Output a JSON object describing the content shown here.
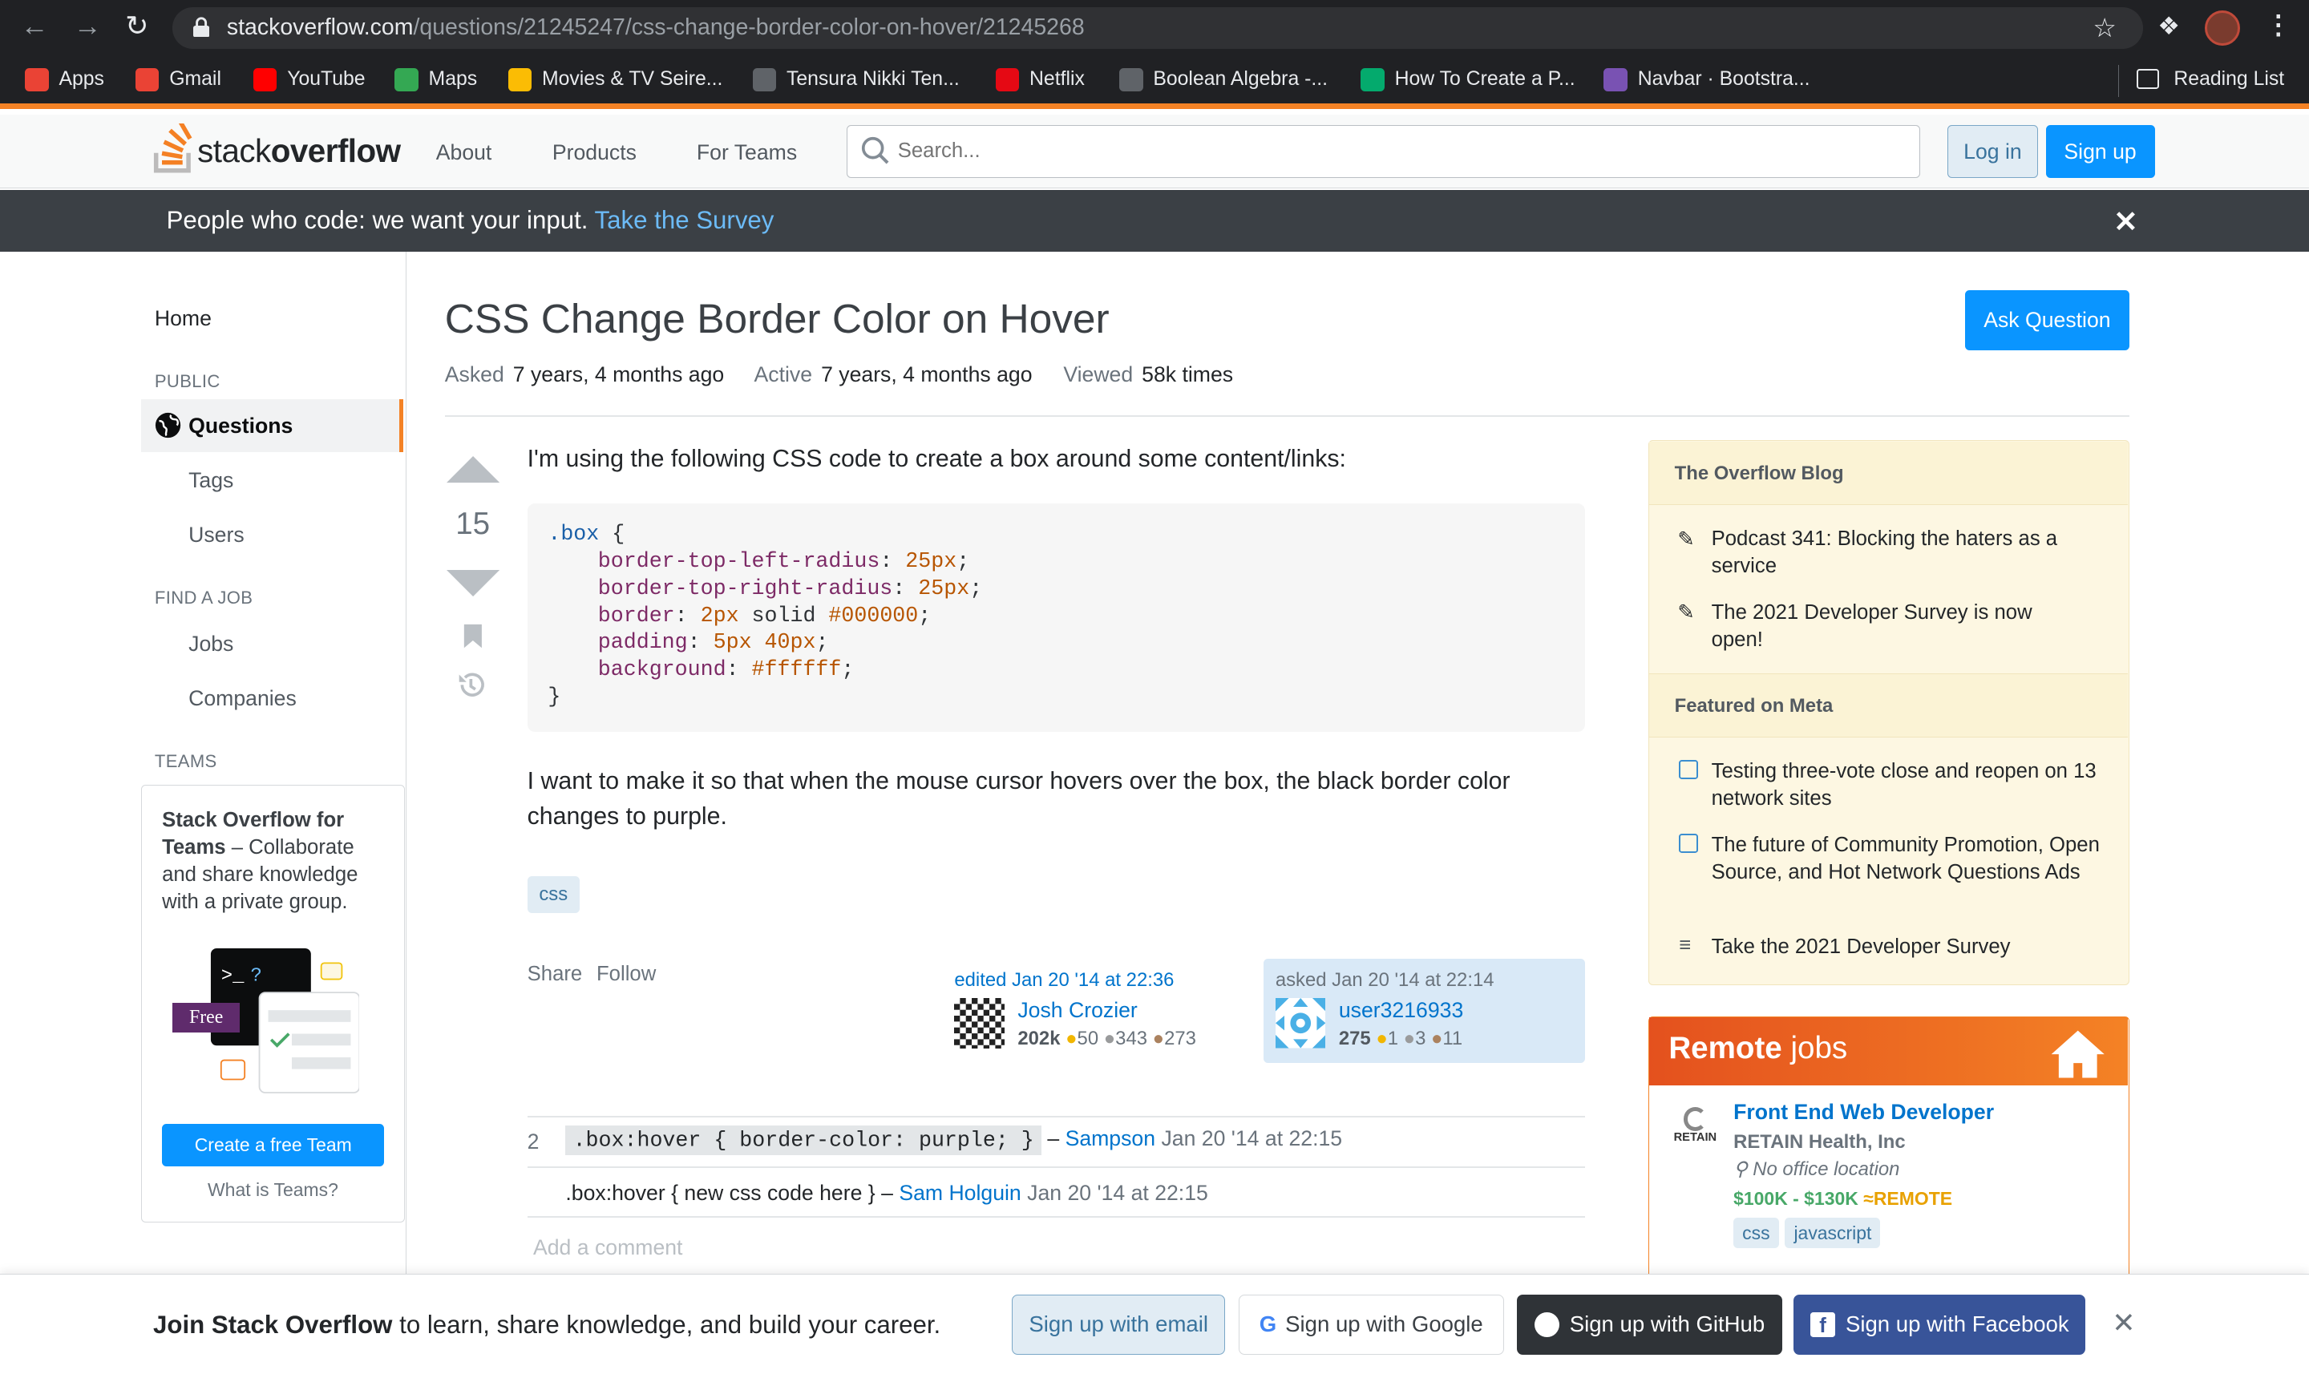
{
  "browser": {
    "url_host": "stackoverflow.com",
    "url_path": "/questions/21245247/css-change-border-color-on-hover/21245268",
    "bookmarks": [
      {
        "label": "Apps",
        "color": "#ea4335"
      },
      {
        "label": "Gmail",
        "color": "#ea4335"
      },
      {
        "label": "YouTube",
        "color": "#ff0000"
      },
      {
        "label": "Maps",
        "color": "#34a853"
      },
      {
        "label": "Movies & TV Seire...",
        "color": "#fbbc04"
      },
      {
        "label": "Tensura Nikki Ten...",
        "color": "#5f6368"
      },
      {
        "label": "Netflix",
        "color": "#e50914"
      },
      {
        "label": "Boolean Algebra -...",
        "color": "#5f6368"
      },
      {
        "label": "How To Create a P...",
        "color": "#04aa6d"
      },
      {
        "label": "Navbar · Bootstra...",
        "color": "#7952b3"
      }
    ],
    "reading_list": "Reading List"
  },
  "header": {
    "logo_a": "stack",
    "logo_b": "overflow",
    "about": "About",
    "products": "Products",
    "teams": "For Teams",
    "search_placeholder": "Search...",
    "login": "Log in",
    "signup": "Sign up"
  },
  "banner": {
    "text": "People who code: we want your input.",
    "link": "Take the Survey"
  },
  "nav": {
    "home": "Home",
    "public": "PUBLIC",
    "questions": "Questions",
    "tags": "Tags",
    "users": "Users",
    "findjob": "FIND A JOB",
    "jobs": "Jobs",
    "companies": "Companies",
    "teams": "TEAMS",
    "teams_title": "Stack Overflow for Teams",
    "teams_dash": " – ",
    "teams_desc": "Collaborate and share knowledge with a private group.",
    "free": "Free",
    "create": "Create a free Team",
    "what": "What is Teams?"
  },
  "question": {
    "title": "CSS Change Border Color on Hover",
    "ask": "Ask Question",
    "asked_label": "Asked",
    "asked": "7 years, 4 months ago",
    "active_label": "Active",
    "active": "7 years, 4 months ago",
    "viewed_label": "Viewed",
    "viewed": "58k times",
    "votes": "15",
    "intro": "I'm using the following CSS code to create a box around some content/links:",
    "outro": "I want to make it so that when the mouse cursor hovers over the box, the black border color changes to purple.",
    "tag": "css",
    "share": "Share",
    "follow": "Follow",
    "edited": "edited Jan 20 '14 at 22:36",
    "editor": "Josh Crozier",
    "editor_rep": "202k",
    "editor_gold": "50",
    "editor_silver": "343",
    "editor_bronze": "273",
    "asked_by": "asked Jan 20 '14 at 22:14",
    "asker": "user3216933",
    "asker_rep": "275",
    "asker_gold": "1",
    "asker_silver": "3",
    "asker_bronze": "11"
  },
  "code": {
    "selector": ".box",
    "open": " {",
    "close": "}",
    "lines": [
      {
        "prop": "border-top-left-radius",
        "val": "25px",
        "rest": ""
      },
      {
        "prop": "border-top-right-radius",
        "val": "25px",
        "rest": ""
      },
      {
        "prop": "border",
        "val": "2px",
        "rest": " solid "
      },
      {
        "prop": "padding",
        "val": "5px 40px",
        "rest": ""
      },
      {
        "prop": "background",
        "val": "#ffffff",
        "rest": ""
      }
    ],
    "border_hex": "#000000"
  },
  "comments": [
    {
      "score": "2",
      "code": ".box:hover { border-color: purple; }",
      "dash": " – ",
      "user": "Sampson",
      "date": "Jan 20 '14 at 22:15"
    },
    {
      "score": "",
      "text": ".box:hover { new css code here }",
      "dash": " – ",
      "user": "Sam Holguin",
      "date": "Jan 20 '14 at 22:15"
    }
  ],
  "add_comment": "Add a comment",
  "sidebar": {
    "blog": "The Overflow Blog",
    "blog_items": [
      "Podcast 341: Blocking the haters as a service",
      "The 2021 Developer Survey is now open!"
    ],
    "meta": "Featured on Meta",
    "meta_items": [
      "Testing three-vote close and reopen on 13 network sites",
      "The future of Community Promotion, Open Source, and Hot Network Questions Ads",
      "Take the 2021 Developer Survey"
    ],
    "remote_a": "Remote",
    "remote_b": " jobs",
    "job_title": "Front End Web Developer",
    "job_company": "RETAIN Health, Inc",
    "job_logo": "RETAIN",
    "job_loc": "No office location",
    "job_salary": "$100K - $130K",
    "job_remote": "REMOTE",
    "job_tags": [
      "css",
      "javascript"
    ]
  },
  "bottom": {
    "join_b": "Join Stack Overflow",
    "join": " to learn, share knowledge, and build your career.",
    "email": "Sign up with email",
    "google": "Sign up with Google",
    "github": "Sign up with GitHub",
    "facebook": "Sign up with Facebook"
  }
}
